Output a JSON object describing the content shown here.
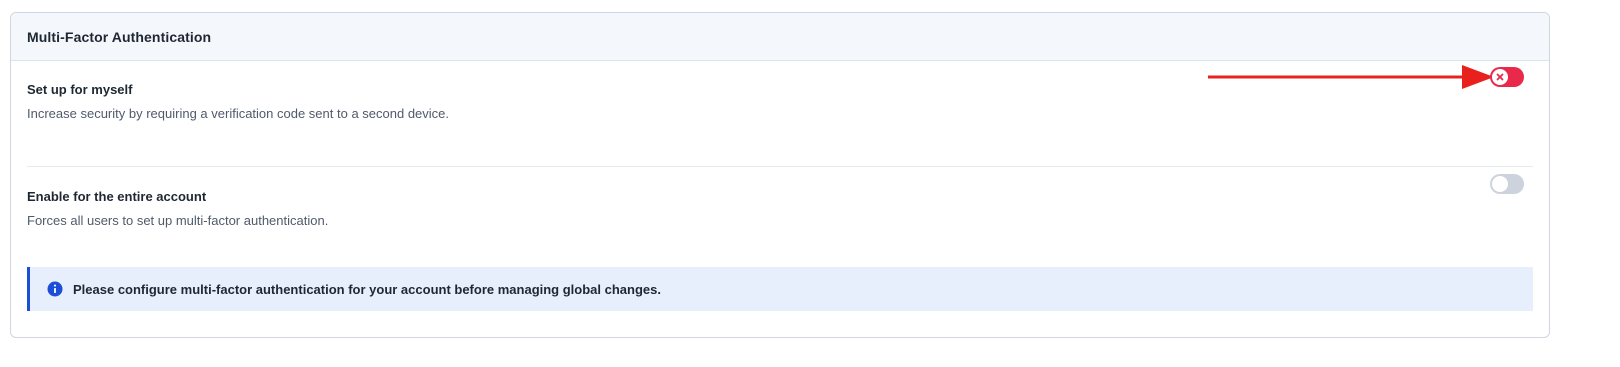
{
  "panel": {
    "title": "Multi-Factor Authentication"
  },
  "settings": [
    {
      "title": "Set up for myself",
      "description": "Increase security by requiring a verification code sent to a second device.",
      "toggle": {
        "state": "off",
        "style": "error",
        "icon": "x-icon"
      }
    },
    {
      "title": "Enable for the entire account",
      "description": "Forces all users to set up multi-factor authentication.",
      "toggle": {
        "state": "off",
        "style": "disabled"
      }
    }
  ],
  "notice": {
    "icon": "info-icon",
    "text": "Please configure multi-factor authentication for your account before managing global changes."
  },
  "annotation": {
    "arrow_color": "#e8211f",
    "points_to": "set-up-for-myself-toggle"
  },
  "colors": {
    "toggle_error": "#e8294a",
    "toggle_disabled": "#cdd3dc",
    "info_accent": "#1d4ed8",
    "info_background": "#e7eefc"
  }
}
